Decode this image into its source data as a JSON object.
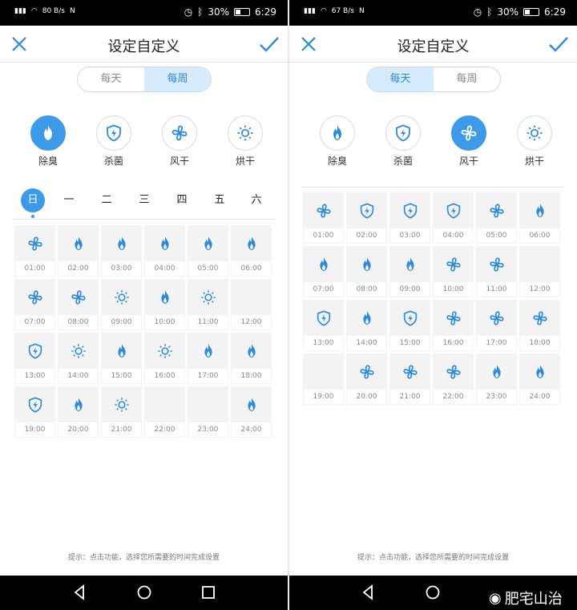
{
  "status_left": {
    "net_speed_left": "80",
    "net_speed_right": "67",
    "unit": "B/s"
  },
  "status_right": {
    "battery": "30%",
    "time": "6:29"
  },
  "header": {
    "title": "设定自定义"
  },
  "segments": [
    "每天",
    "每周"
  ],
  "modes": [
    {
      "label": "除臭",
      "icon": "flame-icon"
    },
    {
      "label": "杀菌",
      "icon": "shield-bolt-icon"
    },
    {
      "label": "风干",
      "icon": "fan-icon"
    },
    {
      "label": "烘干",
      "icon": "sun-icon"
    }
  ],
  "days": [
    "日",
    "一",
    "二",
    "三",
    "四",
    "五",
    "六"
  ],
  "left_panel": {
    "active_segment": 1,
    "active_mode": 0,
    "active_day": 0,
    "slots": [
      {
        "time": "01:00",
        "icon": "fan"
      },
      {
        "time": "02:00",
        "icon": "flame"
      },
      {
        "time": "03:00",
        "icon": "flame"
      },
      {
        "time": "04:00",
        "icon": "flame"
      },
      {
        "time": "05:00",
        "icon": "flame"
      },
      {
        "time": "06:00",
        "icon": "flame"
      },
      {
        "time": "07:00",
        "icon": "fan"
      },
      {
        "time": "08:00",
        "icon": "fan"
      },
      {
        "time": "09:00",
        "icon": "sun"
      },
      {
        "time": "10:00",
        "icon": "flame"
      },
      {
        "time": "11:00",
        "icon": "sun"
      },
      {
        "time": "12:00",
        "icon": ""
      },
      {
        "time": "13:00",
        "icon": "shield"
      },
      {
        "time": "14:00",
        "icon": "sun"
      },
      {
        "time": "15:00",
        "icon": "flame"
      },
      {
        "time": "16:00",
        "icon": "sun"
      },
      {
        "time": "17:00",
        "icon": "flame"
      },
      {
        "time": "18:00",
        "icon": "flame"
      },
      {
        "time": "19:00",
        "icon": "shield"
      },
      {
        "time": "20:00",
        "icon": "flame"
      },
      {
        "time": "21:00",
        "icon": "sun"
      },
      {
        "time": "22:00",
        "icon": ""
      },
      {
        "time": "23:00",
        "icon": ""
      },
      {
        "time": "24:00",
        "icon": "flame"
      }
    ]
  },
  "right_panel": {
    "active_segment": 0,
    "active_mode": 2,
    "slots": [
      {
        "time": "01:00",
        "icon": "fan"
      },
      {
        "time": "02:00",
        "icon": "shield"
      },
      {
        "time": "03:00",
        "icon": "shield"
      },
      {
        "time": "04:00",
        "icon": "shield"
      },
      {
        "time": "05:00",
        "icon": "fan"
      },
      {
        "time": "06:00",
        "icon": "flame"
      },
      {
        "time": "07:00",
        "icon": "flame"
      },
      {
        "time": "08:00",
        "icon": "flame"
      },
      {
        "time": "09:00",
        "icon": "flame"
      },
      {
        "time": "10:00",
        "icon": "fan"
      },
      {
        "time": "11:00",
        "icon": "fan"
      },
      {
        "time": "12:00",
        "icon": ""
      },
      {
        "time": "13:00",
        "icon": "shield"
      },
      {
        "time": "14:00",
        "icon": "flame"
      },
      {
        "time": "15:00",
        "icon": "shield"
      },
      {
        "time": "16:00",
        "icon": "fan"
      },
      {
        "time": "17:00",
        "icon": "fan"
      },
      {
        "time": "18:00",
        "icon": "fan"
      },
      {
        "time": "19:00",
        "icon": ""
      },
      {
        "time": "20:00",
        "icon": "fan"
      },
      {
        "time": "21:00",
        "icon": "fan"
      },
      {
        "time": "22:00",
        "icon": "fan"
      },
      {
        "time": "23:00",
        "icon": "flame"
      },
      {
        "time": "24:00",
        "icon": "flame"
      }
    ]
  },
  "hint": "提示：点击功能，选择您所需要的时间完成设置",
  "watermark": "肥宅山治",
  "colors": {
    "accent": "#3d9ae8",
    "icon": "#2b8be0",
    "segment_active_bg": "#d6ebfb",
    "cell_bg": "#f3f3f3"
  }
}
